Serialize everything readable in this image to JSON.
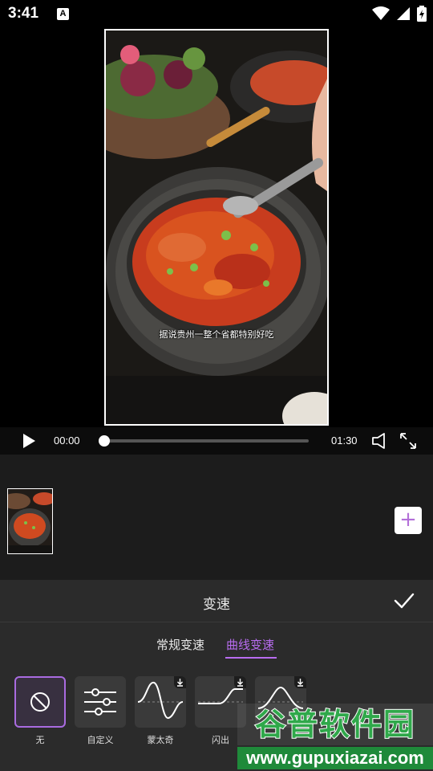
{
  "status_bar": {
    "time": "3:41",
    "notification_badge": "A",
    "icons": [
      "wifi-icon",
      "cell-signal-icon",
      "battery-charging-icon"
    ]
  },
  "preview": {
    "subtitle": "据说贵州一整个省都特别好吃"
  },
  "player": {
    "current_time": "00:00",
    "total_time": "01:30",
    "progress": 0.0
  },
  "timeline": {
    "add_label": "+"
  },
  "speed_panel": {
    "title": "变速",
    "tabs": [
      {
        "label": "常规变速",
        "active": false
      },
      {
        "label": "曲线变速",
        "active": true
      }
    ],
    "presets": [
      {
        "label": "无",
        "icon": "none-icon",
        "selected": true,
        "downloadable": false
      },
      {
        "label": "自定义",
        "icon": "sliders-icon",
        "selected": false,
        "downloadable": false
      },
      {
        "label": "蒙太奇",
        "icon": "curve-montage-icon",
        "selected": false,
        "downloadable": true
      },
      {
        "label": "闪出",
        "icon": "curve-flash-out-icon",
        "selected": false,
        "downloadable": true
      },
      {
        "label": "",
        "icon": "curve-flash-in-icon",
        "selected": false,
        "downloadable": true
      }
    ]
  },
  "watermark": {
    "line1": "谷普软件园",
    "line2": "www.gupuxiazai.com"
  },
  "colors": {
    "accent": "#b86cf0",
    "panel_bg": "#2b2b2b",
    "timeline_bg": "#1c1c1c"
  }
}
